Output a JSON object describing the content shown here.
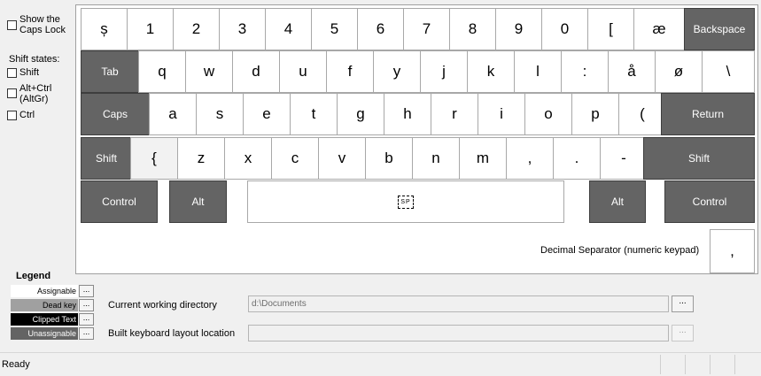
{
  "options": {
    "caps_lock_line1": "Show the",
    "caps_lock_line2": "Caps Lock",
    "shift_states_label": "Shift states:",
    "shift": "Shift",
    "altgr_line1": "Alt+Ctrl",
    "altgr_line2": "(AltGr)",
    "ctrl": "Ctrl"
  },
  "keyboard": {
    "rows": [
      [
        "ș",
        "1",
        "2",
        "3",
        "4",
        "5",
        "6",
        "7",
        "8",
        "9",
        "0",
        "[",
        "æ",
        "Backspace"
      ],
      [
        "Tab",
        "q",
        "w",
        "d",
        "u",
        "f",
        "y",
        "j",
        "k",
        "l",
        ":",
        "å",
        "ø",
        "\\"
      ],
      [
        "Caps",
        "a",
        "s",
        "e",
        "t",
        "g",
        "h",
        "r",
        "i",
        "o",
        "p",
        "(",
        "Return"
      ],
      [
        "Shift",
        "{",
        "z",
        "x",
        "c",
        "v",
        "b",
        "n",
        "m",
        ",",
        ".",
        "-",
        "Shift"
      ],
      [
        "Control",
        "Alt",
        "SP",
        "Alt",
        "Control"
      ]
    ],
    "decimal_separator_label": "Decimal Separator (numeric keypad)",
    "decimal_key": ","
  },
  "legend": {
    "title": "Legend",
    "assignable": "Assignable",
    "dead_key": "Dead key",
    "clipped_text": "Clipped Text",
    "unassignable": "Unassignable",
    "colors": {
      "assignable": "#ffffff",
      "dead_key": "#a0a0a0",
      "clipped_text": "#000000",
      "unassignable": "#646464"
    }
  },
  "fields": {
    "cwd_label": "Current working directory",
    "cwd_value": "d:\\Documents",
    "built_label": "Built keyboard layout location",
    "built_value": "",
    "browse": "..."
  },
  "status": {
    "text": "Ready"
  }
}
